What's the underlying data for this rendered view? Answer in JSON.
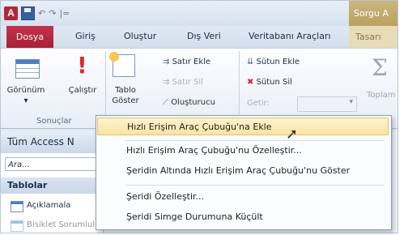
{
  "titlebar": {
    "app_icon_letter": "A",
    "qat_undo": "↶",
    "qat_redo": "↷",
    "qat_customize": "|=",
    "context_tab_title": "Sorgu A"
  },
  "tabs": {
    "file": "Dosya",
    "home": "Giriş",
    "create": "Oluştur",
    "external": "Dış Veri",
    "tools": "Veritabanı Araçları",
    "context": "Tasarı"
  },
  "ribbon": {
    "view_label": "Görünüm",
    "view_arrow": "▾",
    "run_label": "Çalıştır",
    "run_icon": "!",
    "show_table_line1": "Tablo",
    "show_table_line2": "Göster",
    "insert_row": "Satır Ekle",
    "delete_row": "Satır Sil",
    "builder": "Oluşturucu",
    "insert_column": "Sütun Ekle",
    "delete_column": "Sütun Sil",
    "return": "Getir:",
    "results_group": "Sonuçlar",
    "totals": "Toplam",
    "sigma": "Σ"
  },
  "navpane": {
    "title": "Tüm Access N",
    "search_placeholder": "Ara...",
    "section": "Tablolar",
    "items": [
      "Açıklamala",
      "Bisiklet Sorumlul"
    ]
  },
  "context_menu": {
    "items": [
      "Hızlı Erişim Araç Çubuğu'na Ekle",
      "Hızlı Erişim Araç Çubuğu'nu Özelleştir...",
      "Şeridin Altında Hızlı Erişim Araç Çubuğu'nu Göster",
      "Şeridi Özelleştir...",
      "Şeridi Simge Durumuna Küçült"
    ]
  },
  "colors": {
    "file_tab": "#b52a42",
    "menu_hover": "#fbe4a3",
    "context_tab": "#c9b77f"
  }
}
